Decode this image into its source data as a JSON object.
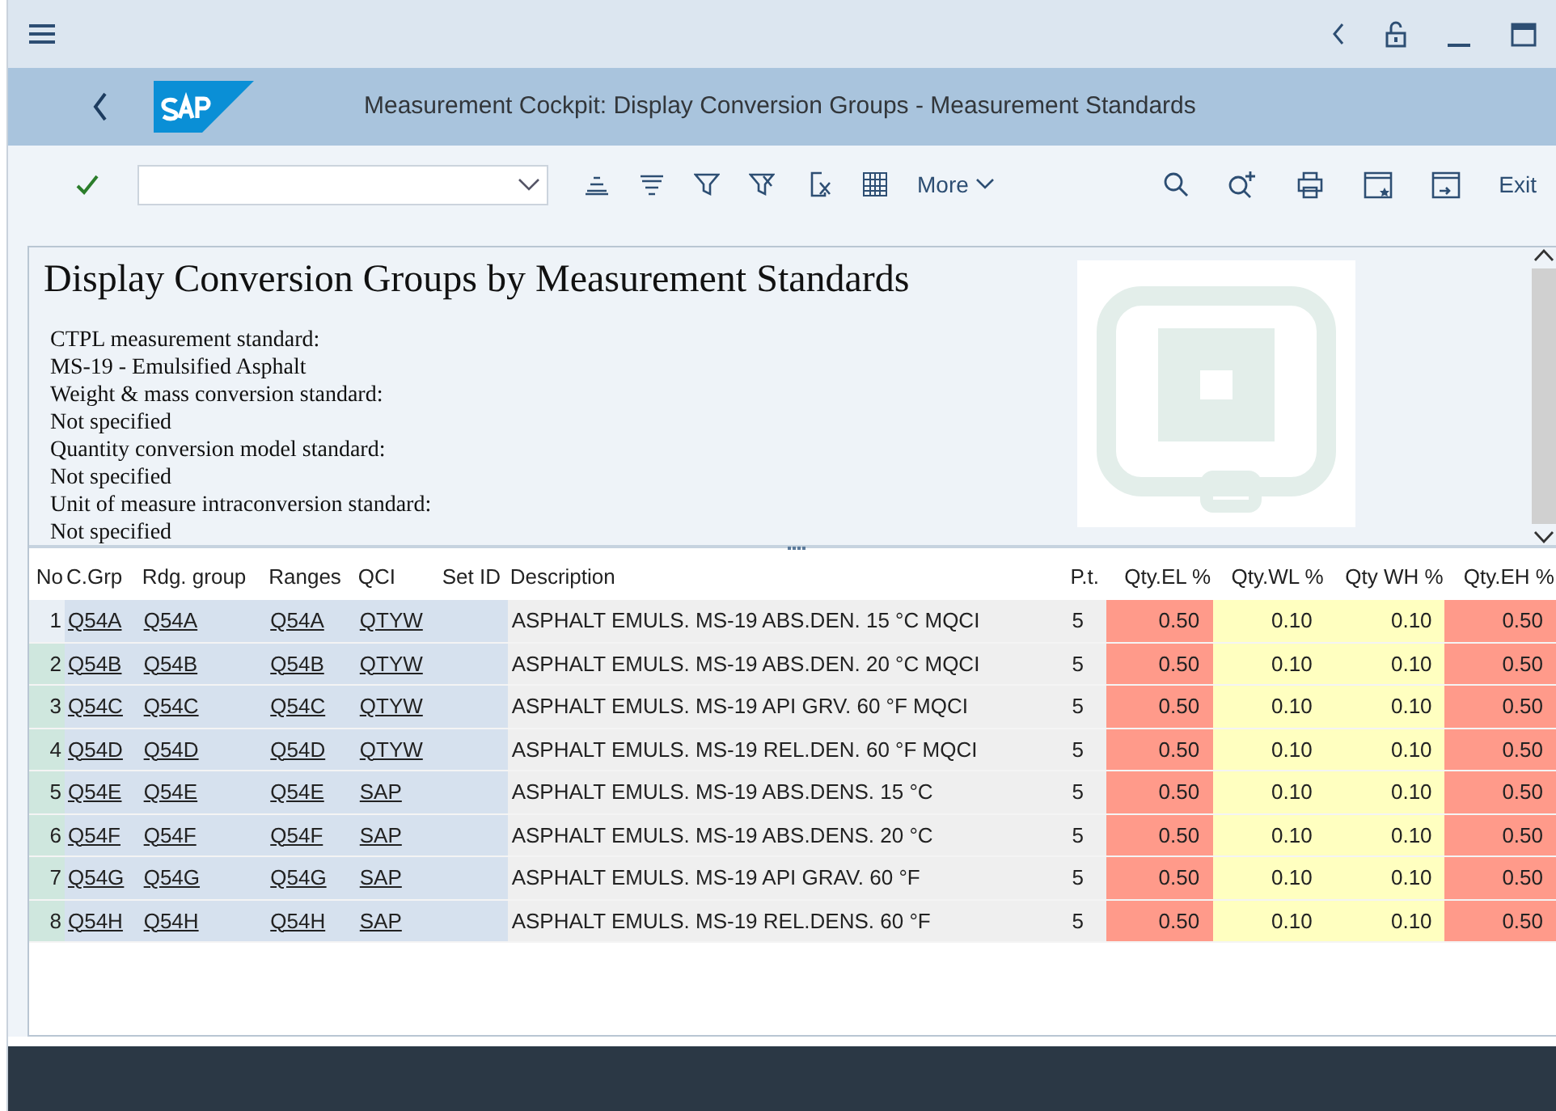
{
  "window": {
    "title": "Measurement Cockpit: Display Conversion Groups - Measurement Standards",
    "exit": "Exit"
  },
  "toolbar": {
    "more": "More"
  },
  "report": {
    "heading": "Display Conversion Groups by Measurement Standards",
    "lines": [
      "CTPL measurement standard:",
      "MS-19 - Emulsified Asphalt",
      "Weight & mass conversion standard:",
      "Not specified",
      "Quantity conversion model standard:",
      "Not specified",
      "Unit of measure intraconversion standard:",
      "Not specified"
    ]
  },
  "table": {
    "columns": [
      {
        "label": "No",
        "kind": "no"
      },
      {
        "label": "C.Grp",
        "kind": "key"
      },
      {
        "label": "Rdg. group",
        "kind": "key"
      },
      {
        "label": "Ranges",
        "kind": "key"
      },
      {
        "label": "QCI",
        "kind": "key"
      },
      {
        "label": "Set ID",
        "kind": "key"
      },
      {
        "label": "Description",
        "kind": "text"
      },
      {
        "label": "P.t.",
        "kind": "text"
      },
      {
        "label": "Qty.EL %",
        "kind": "error"
      },
      {
        "label": "Qty.WL %",
        "kind": "warning"
      },
      {
        "label": "Qty WH %",
        "kind": "warning"
      },
      {
        "label": "Qty.EH %",
        "kind": "error"
      }
    ],
    "rows": [
      {
        "selected": true,
        "cells": [
          "1",
          "Q54A",
          "Q54A",
          "Q54A",
          "QTYW",
          "",
          "ASPHALT EMULS. MS-19 ABS.DEN. 15 °C MQCI",
          "5",
          "0.50",
          "0.10",
          "0.10",
          "0.50"
        ]
      },
      {
        "selected": false,
        "cells": [
          "2",
          "Q54B",
          "Q54B",
          "Q54B",
          "QTYW",
          "",
          "ASPHALT EMULS. MS-19 ABS.DEN. 20 °C MQCI",
          "5",
          "0.50",
          "0.10",
          "0.10",
          "0.50"
        ]
      },
      {
        "selected": false,
        "cells": [
          "3",
          "Q54C",
          "Q54C",
          "Q54C",
          "QTYW",
          "",
          "ASPHALT EMULS. MS-19 API GRV. 60 °F MQCI",
          "5",
          "0.50",
          "0.10",
          "0.10",
          "0.50"
        ]
      },
      {
        "selected": false,
        "cells": [
          "4",
          "Q54D",
          "Q54D",
          "Q54D",
          "QTYW",
          "",
          "ASPHALT EMULS. MS-19 REL.DEN. 60 °F MQCI",
          "5",
          "0.50",
          "0.10",
          "0.10",
          "0.50"
        ]
      },
      {
        "selected": false,
        "cells": [
          "5",
          "Q54E",
          "Q54E",
          "Q54E",
          "SAP",
          "",
          "ASPHALT EMULS. MS-19 ABS.DENS. 15 °C",
          "5",
          "0.50",
          "0.10",
          "0.10",
          "0.50"
        ]
      },
      {
        "selected": false,
        "cells": [
          "6",
          "Q54F",
          "Q54F",
          "Q54F",
          "SAP",
          "",
          "ASPHALT EMULS. MS-19 ABS.DENS. 20 °C",
          "5",
          "0.50",
          "0.10",
          "0.10",
          "0.50"
        ]
      },
      {
        "selected": false,
        "cells": [
          "7",
          "Q54G",
          "Q54G",
          "Q54G",
          "SAP",
          "",
          "ASPHALT EMULS. MS-19 API GRAV. 60 °F",
          "5",
          "0.50",
          "0.10",
          "0.10",
          "0.50"
        ]
      },
      {
        "selected": false,
        "cells": [
          "8",
          "Q54H",
          "Q54H",
          "Q54H",
          "SAP",
          "",
          "ASPHALT EMULS. MS-19 REL.DENS. 60 °F",
          "5",
          "0.50",
          "0.10",
          "0.10",
          "0.50"
        ]
      }
    ]
  }
}
